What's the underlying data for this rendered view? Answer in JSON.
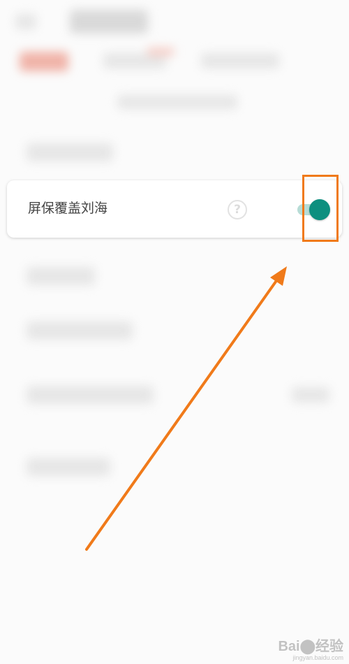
{
  "setting": {
    "label": "屏保覆盖刘海",
    "help_glyph": "?",
    "toggle_on": true
  },
  "watermark": {
    "main": "Bai⬤经验",
    "sub": "jingyan.baidu.com"
  },
  "colors": {
    "toggle_accent": "#0d8f7f",
    "toggle_track": "#b7dcd6",
    "annotation": "#f07a1a"
  }
}
